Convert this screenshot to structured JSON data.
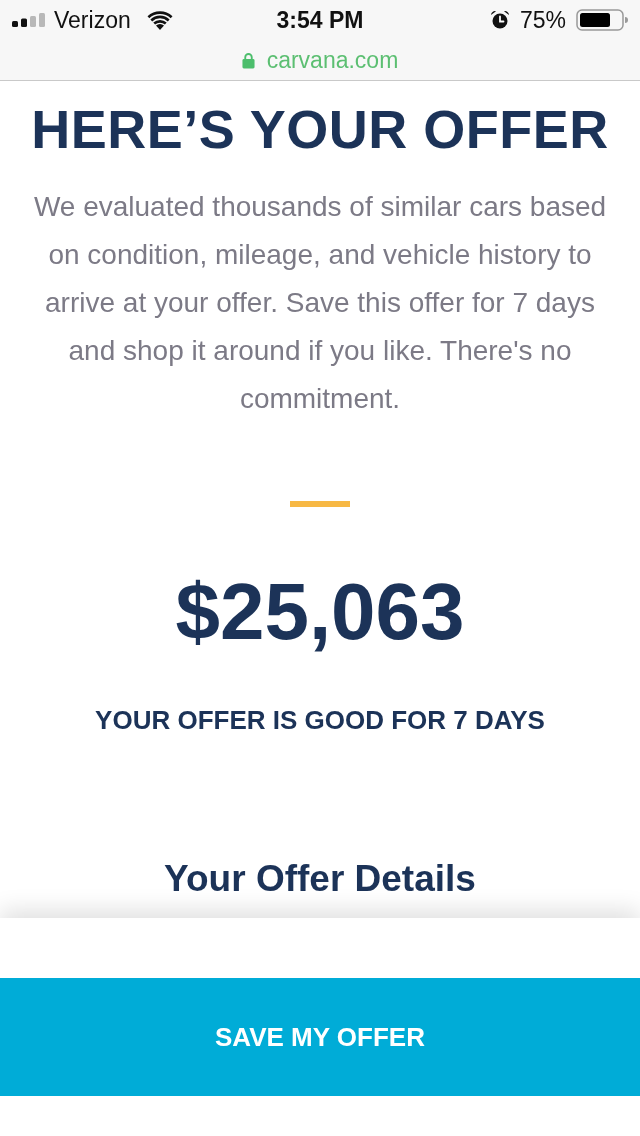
{
  "status_bar": {
    "carrier": "Verizon",
    "time": "3:54 PM",
    "battery": "75%"
  },
  "address_bar": {
    "url": "carvana.com",
    "secure": true
  },
  "offer": {
    "title": "HERE’S YOUR OFFER",
    "description": "We evaluated thousands of similar cars based on condition, mileage, and vehicle history to arrive at your offer. Save this offer for 7 days and shop it around if you like. There's no commitment.",
    "amount": "$25,063",
    "validity": "YOUR OFFER IS GOOD FOR 7 DAYS"
  },
  "details": {
    "title": "Your Offer Details"
  },
  "actions": [
    {
      "label": "SAVE MY OFFER"
    }
  ]
}
